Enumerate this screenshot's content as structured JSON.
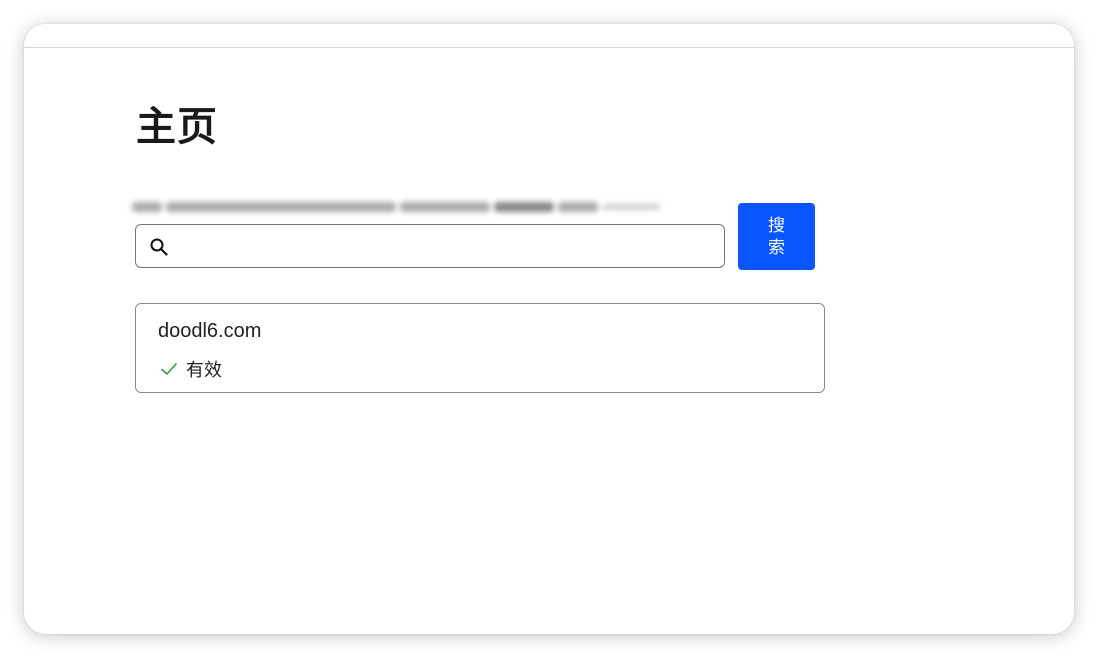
{
  "page": {
    "title": "主页"
  },
  "search": {
    "value": "",
    "placeholder": "",
    "button_label": "搜索"
  },
  "results": [
    {
      "domain": "doodl6.com",
      "status": "有效",
      "status_icon": "check-icon"
    }
  ],
  "colors": {
    "accent": "#0a55ff",
    "valid": "#2e9d4a"
  }
}
